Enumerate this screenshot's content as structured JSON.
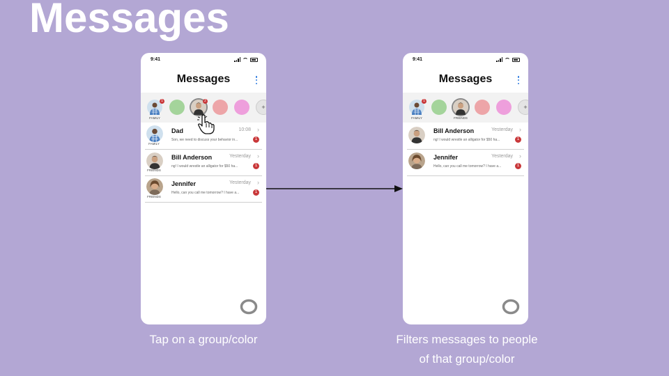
{
  "slide": {
    "title": "Messages"
  },
  "captions": {
    "left": "Tap on a group/color",
    "right_line1": "Filters messages to people",
    "right_line2": "of that group/color"
  },
  "colors": {
    "background": "#b3a7d4",
    "badge": "#c9383a",
    "group_green": "#a4d49b",
    "group_pink": "#eda5a8",
    "group_magenta": "#ee9fdc",
    "kebab": "#2d7be0"
  },
  "phone_left": {
    "status_time": "9:41",
    "header_title": "Messages",
    "groups": {
      "family_label": "FAMILY",
      "family_badge": "1",
      "friends_badge": "2",
      "plus": "+"
    },
    "messages": [
      {
        "name": "Dad",
        "time": "10:08",
        "preview": "Son, we need to discuss your behavior in...",
        "badge": "1",
        "group": "FAMILY"
      },
      {
        "name": "Bill Anderson",
        "time": "Yesterday",
        "preview": "ng! I would wrestle an alligator for $50 ha...",
        "badge": "1",
        "group": "FRIENDS"
      },
      {
        "name": "Jennifer",
        "time": "Yesterday",
        "preview": "Hello, can you call me tomorrow? I have a...",
        "badge": "1",
        "group": "FRIENDS"
      }
    ]
  },
  "phone_right": {
    "status_time": "9:41",
    "header_title": "Messages",
    "groups": {
      "family_label": "FAMILY",
      "friends_label": "FRIENDS",
      "family_badge": "1",
      "plus": "+"
    },
    "messages": [
      {
        "name": "Bill Anderson",
        "time": "Yesterday",
        "preview": "ng! I would wrestle an alligator for $50 ha...",
        "badge": "1"
      },
      {
        "name": "Jennifer",
        "time": "Yesterday",
        "preview": "Hello, can you call me tomorrow? I have a...",
        "badge": "1"
      }
    ]
  }
}
